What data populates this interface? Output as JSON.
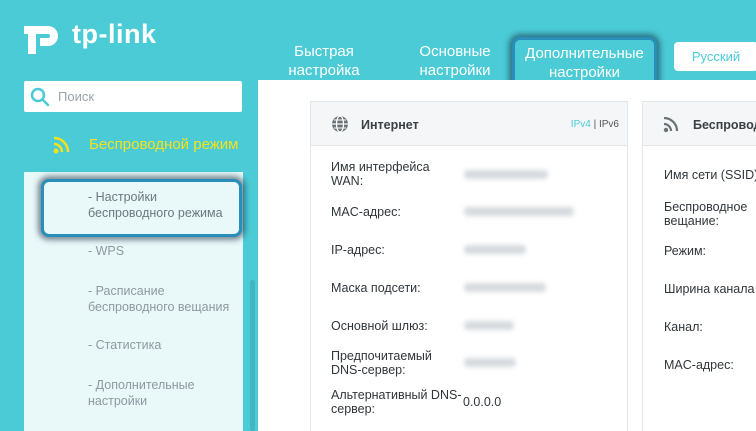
{
  "brand": {
    "logo_text": "tp-link"
  },
  "nav": {
    "quick_setup": "Быстрая настройка",
    "basic": "Основные настройки",
    "advanced": "Дополнительные настройки",
    "language": "Русский"
  },
  "search": {
    "placeholder": "Поиск"
  },
  "sidebar": {
    "section": "Беспроводной режим",
    "items": [
      {
        "label": "- Настройки беспроводного режима",
        "active": true
      },
      {
        "label": "- WPS"
      },
      {
        "label": "- Расписание беспроводного вещания"
      },
      {
        "label": "- Статистика"
      },
      {
        "label": "- Дополнительные настройки"
      }
    ]
  },
  "internet_card": {
    "title": "Интернет",
    "ipv4": "IPv4",
    "separator": "|",
    "ipv6": "IPv6",
    "rows": [
      {
        "label": "Имя интерфейса WAN:"
      },
      {
        "label": "MAC-адрес:"
      },
      {
        "label": "IP-адрес:"
      },
      {
        "label": "Маска подсети:"
      },
      {
        "label": "Основной шлюз:"
      },
      {
        "label": "Предпочитаемый DNS-сервер:"
      },
      {
        "label": "Альтернативный DNS-сервер:",
        "value": "0.0.0.0"
      }
    ]
  },
  "wireless_card": {
    "title": "Беспроводной",
    "rows": [
      {
        "label": "Имя сети (SSID)"
      },
      {
        "label": "Беспроводное вещание:"
      },
      {
        "label": "Режим:"
      },
      {
        "label": "Ширина канала"
      },
      {
        "label": "Канал:"
      },
      {
        "label": "MAC-адрес:"
      }
    ]
  },
  "colors": {
    "accent": "#4acbd6",
    "highlight_border": "#2a8fb8",
    "section_label": "#f5e21a"
  }
}
